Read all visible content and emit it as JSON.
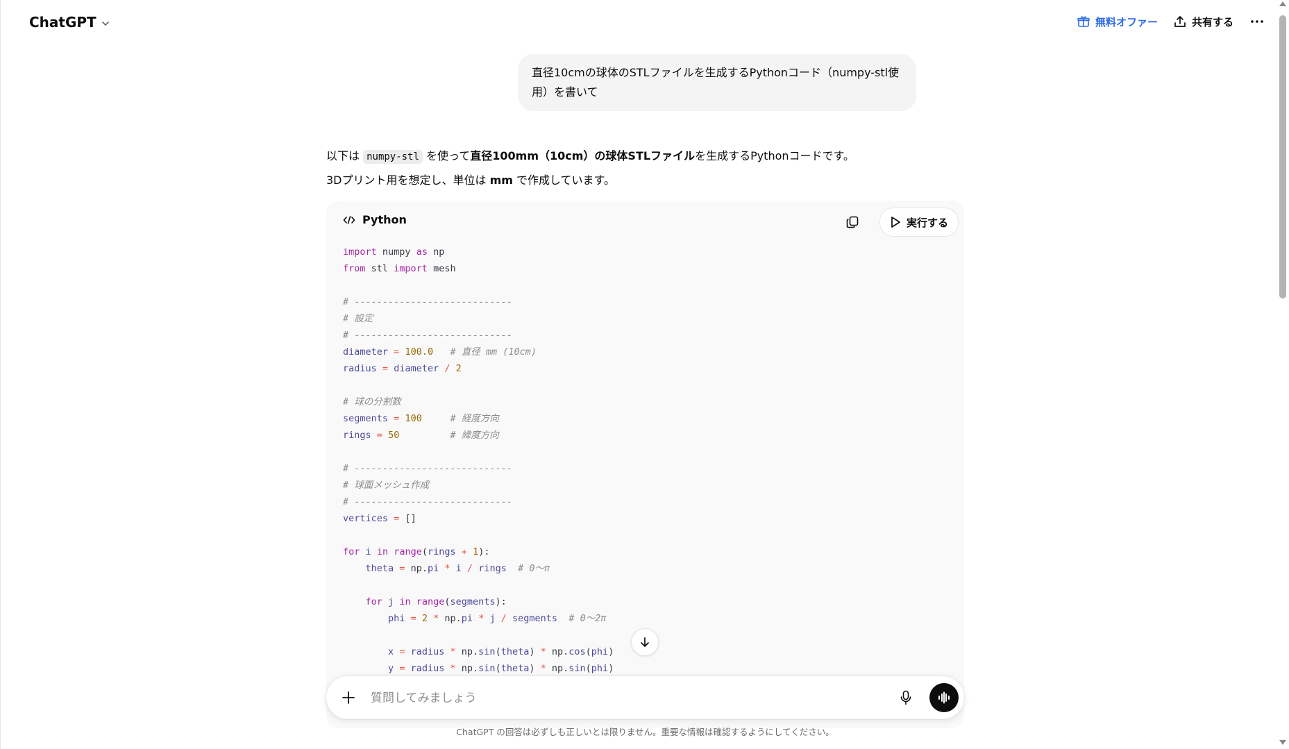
{
  "header": {
    "title": "ChatGPT",
    "offer_label": "無料オファー",
    "share_label": "共有する"
  },
  "user_message": "直径10cmの球体のSTLファイルを生成するPythonコード（numpy-stl使用）を書いて",
  "assistant": {
    "line1": {
      "part1": "以下は ",
      "code": "numpy-stl",
      "part2": " を使って",
      "bold": "直径100mm（10cm）の球体STLファイル",
      "part3": "を生成するPythonコードです。"
    },
    "line2": {
      "part1": "3Dプリント用を想定し、単位は ",
      "bold": "mm",
      "part2": " で作成しています。"
    }
  },
  "code_block": {
    "language": "Python",
    "run_label": "実行する",
    "lines": [
      "import numpy as np",
      "from stl import mesh",
      "",
      "# ----------------------------",
      "# 設定",
      "# ----------------------------",
      "diameter = 100.0   # 直径 mm (10cm)",
      "radius = diameter / 2",
      "",
      "# 球の分割数",
      "segments = 100     # 経度方向",
      "rings = 50         # 緯度方向",
      "",
      "# ----------------------------",
      "# 球面メッシュ作成",
      "# ----------------------------",
      "vertices = []",
      "",
      "for i in range(rings + 1):",
      "    theta = np.pi * i / rings  # 0〜π",
      "",
      "    for j in range(segments):",
      "        phi = 2 * np.pi * j / segments  # 0〜2π",
      "",
      "        x = radius * np.sin(theta) * np.cos(phi)",
      "        y = radius * np.sin(theta) * np.sin(phi)"
    ]
  },
  "composer": {
    "placeholder": "質問してみましょう"
  },
  "disclaimer": "ChatGPT の回答は必ずしも正しいとは限りません。重要な情報は確認するようにしてください。"
}
